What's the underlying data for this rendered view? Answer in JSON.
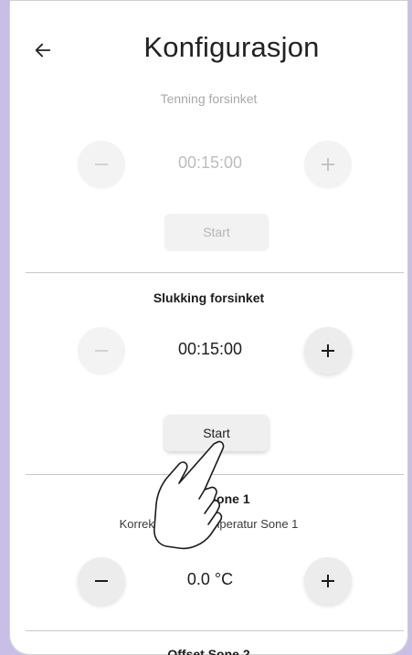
{
  "appbar": {
    "title": "Konfigurasjon",
    "back_icon": "arrow-left-icon"
  },
  "sections": [
    {
      "title": "Tenning forsinket",
      "value": "00:15:00",
      "start_label": "Start",
      "enabled": false
    },
    {
      "title": "Slukking forsinket",
      "value": "00:15:00",
      "start_label": "Start",
      "enabled": true
    },
    {
      "title": "Offset Sone 1",
      "subtitle": "Korreksjon romtemperatur Sone 1",
      "value": "0.0 °C",
      "enabled": true
    },
    {
      "title": "Offset Sone 2"
    }
  ],
  "colors": {
    "frame": "#c9bfe6",
    "button": "#ececec",
    "disabled_text": "#b5b5b5"
  }
}
